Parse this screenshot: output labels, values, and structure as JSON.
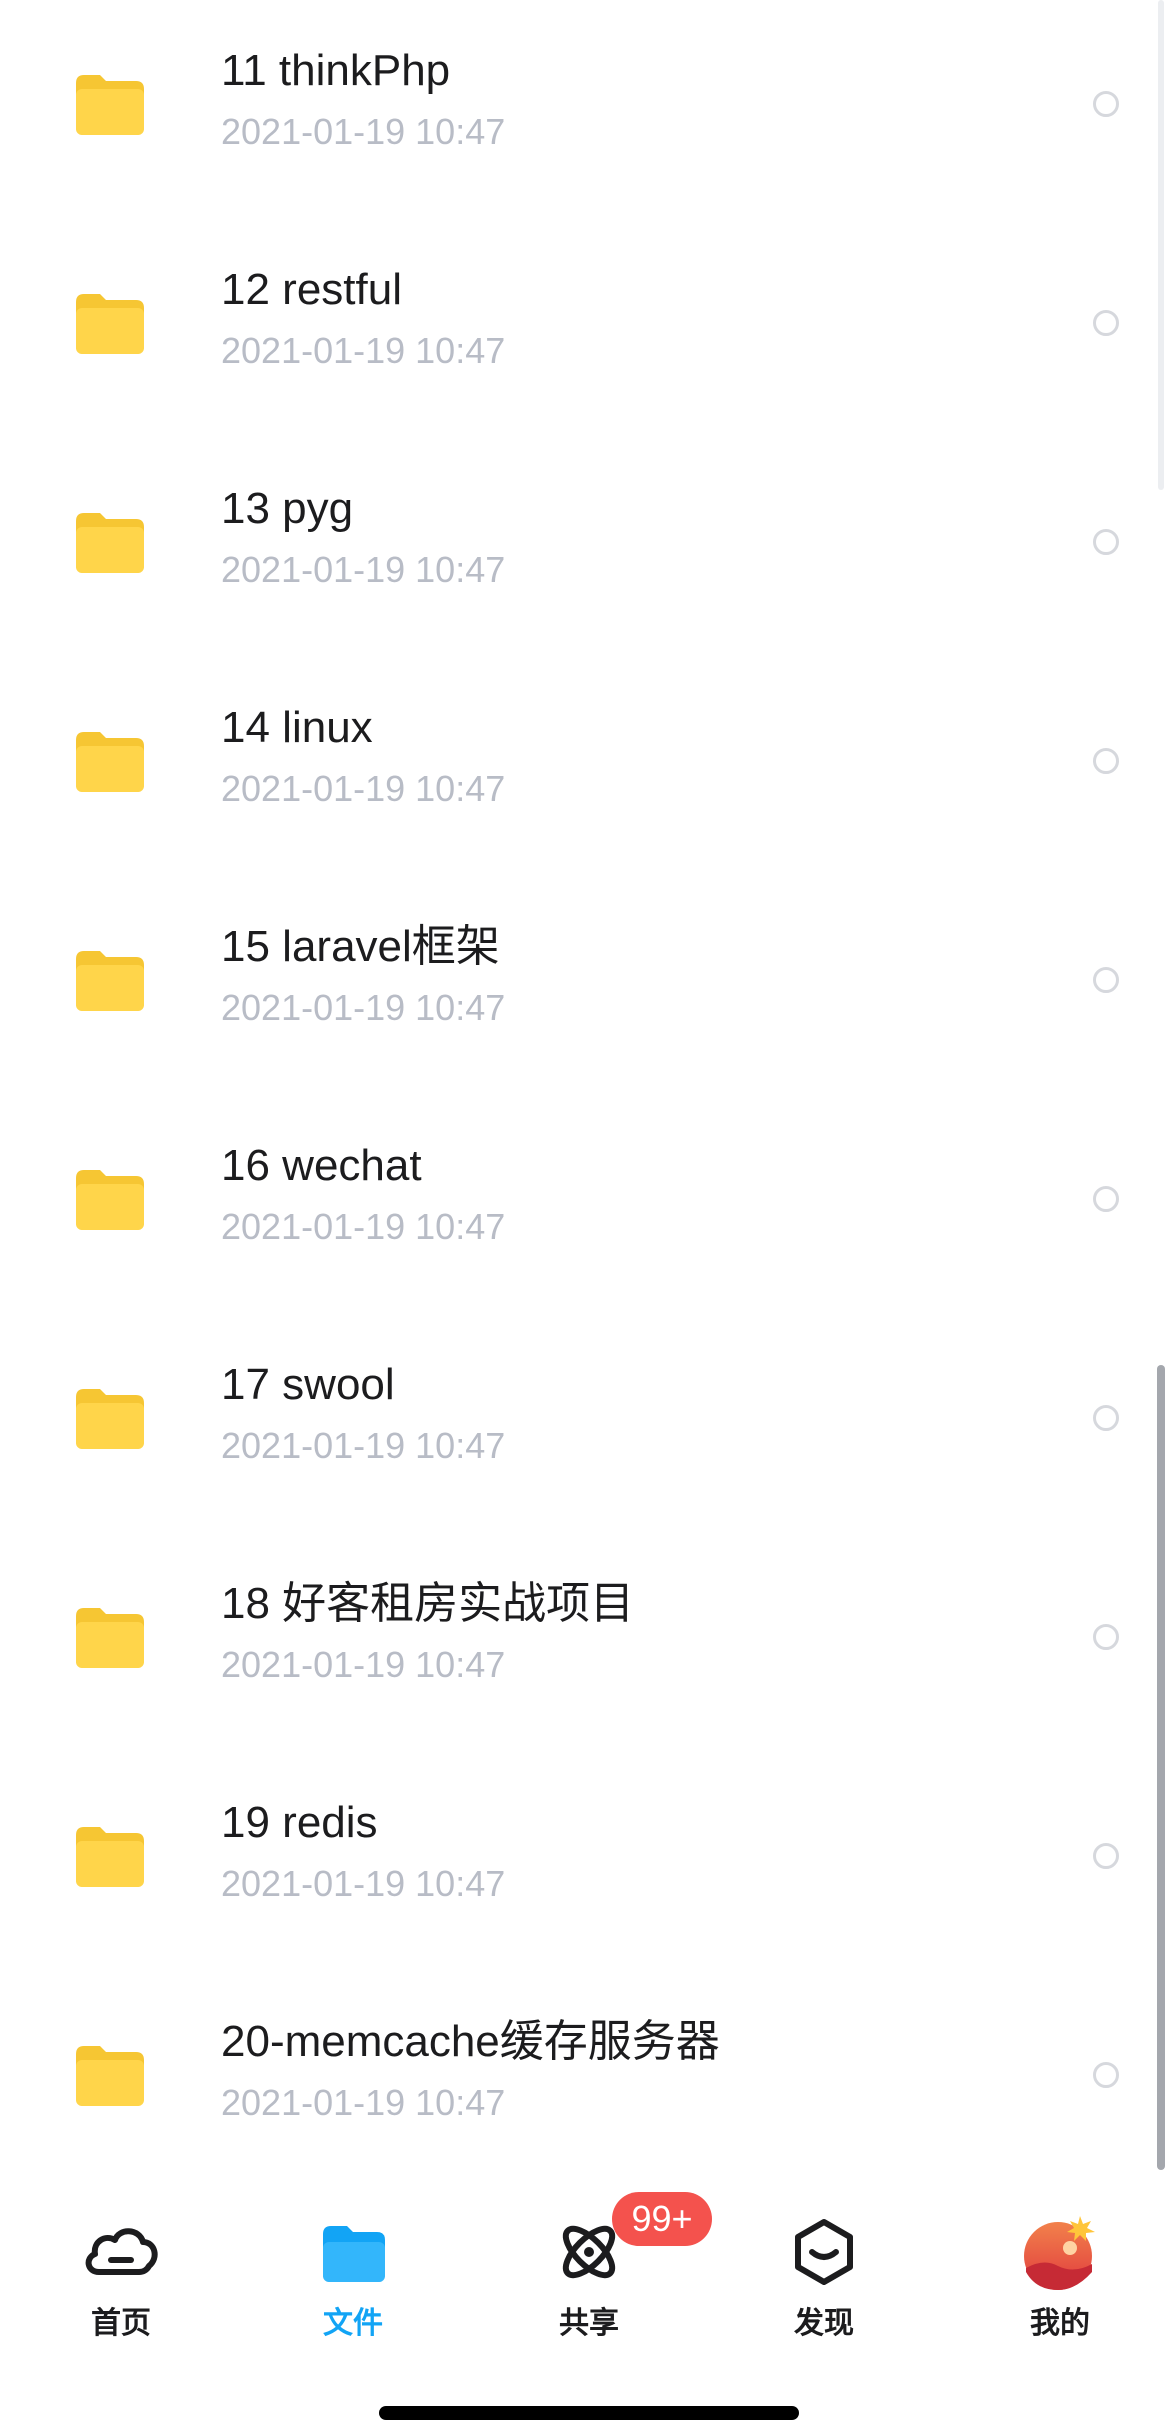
{
  "files": [
    {
      "name": "11 thinkPhp",
      "date": "2021-01-19 10:47"
    },
    {
      "name": "12 restful",
      "date": "2021-01-19 10:47"
    },
    {
      "name": "13 pyg",
      "date": "2021-01-19 10:47"
    },
    {
      "name": "14 linux",
      "date": "2021-01-19 10:47"
    },
    {
      "name": "15 laravel框架",
      "date": "2021-01-19 10:47"
    },
    {
      "name": "16 wechat",
      "date": "2021-01-19 10:47"
    },
    {
      "name": "17 swool",
      "date": "2021-01-19 10:47"
    },
    {
      "name": "18 好客租房实战项目",
      "date": "2021-01-19 10:47"
    },
    {
      "name": "19 redis",
      "date": "2021-01-19 10:47"
    },
    {
      "name": "20-memcache缓存服务器",
      "date": "2021-01-19 10:47"
    }
  ],
  "row_icon": "folder-icon",
  "tab_bar": {
    "tabs": [
      {
        "label": "首页",
        "icon": "cloud-icon",
        "active": false
      },
      {
        "label": "文件",
        "icon": "folder-tab-icon",
        "active": true
      },
      {
        "label": "共享",
        "icon": "orbit-icon",
        "active": false
      },
      {
        "label": "发现",
        "icon": "discover-box-icon",
        "active": false
      },
      {
        "label": "我的",
        "icon": "avatar-icon",
        "active": false
      }
    ],
    "share_badge": "99+"
  },
  "colors": {
    "folder": "#ffd54a",
    "accent": "#12a4f5",
    "badge": "#f4524d",
    "date_text": "#b8bcc6"
  }
}
